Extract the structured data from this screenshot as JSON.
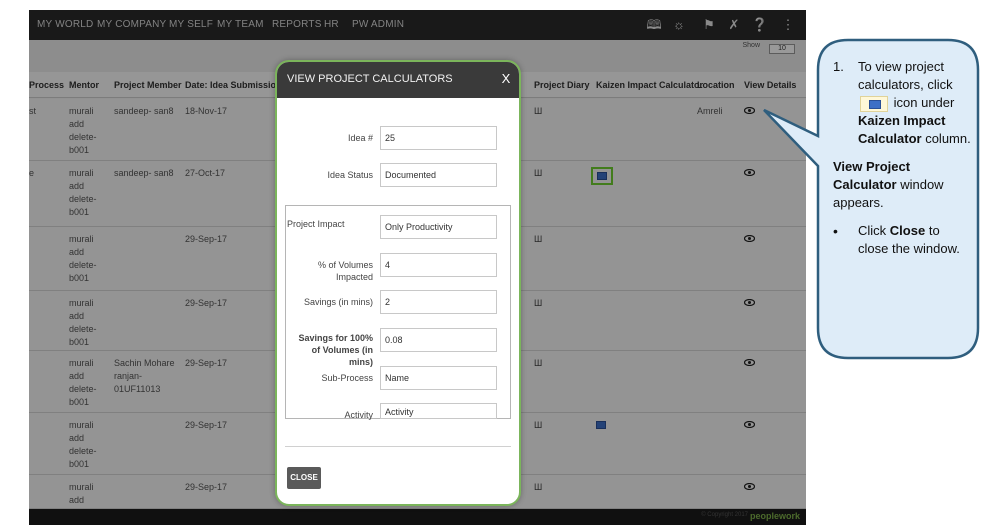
{
  "nav": {
    "items": [
      "MY WORLD",
      "MY COMPANY",
      "MY SELF",
      "MY TEAM",
      "REPORTS",
      "HR",
      "PW ADMIN"
    ],
    "icons": [
      "map-icon",
      "bulb-icon",
      "flag-icon",
      "tools-icon",
      "help-icon",
      "share-icon"
    ]
  },
  "show_label": "Show",
  "show_value": "10",
  "table": {
    "headers": {
      "process": "Process",
      "mentor": "Mentor",
      "member": "Project Member",
      "date": "Date: Idea Submission",
      "diary": "Project Diary",
      "kaizen": "Kaizen Impact Calculator",
      "location": "Location",
      "details": "View Details"
    },
    "rows": [
      {
        "process": "st",
        "mentor": "murali add delete-b001",
        "member": "sandeep- san8",
        "date": "18-Nov-17",
        "location": "Amreli",
        "calc": false
      },
      {
        "process": "e",
        "mentor": "murali add delete-b001",
        "member": "sandeep- san8",
        "date": "27-Oct-17",
        "location": "",
        "calc": true
      },
      {
        "process": "",
        "mentor": "murali add delete-b001",
        "member": "",
        "date": "29-Sep-17",
        "location": "",
        "calc": false
      },
      {
        "process": "",
        "mentor": "murali add delete-b001",
        "member": "",
        "date": "29-Sep-17",
        "location": "",
        "calc": false
      },
      {
        "process": "",
        "mentor": "murali add delete-b001",
        "member": "Sachin Mohare ranjan-01UF11013",
        "date": "29-Sep-17",
        "location": "",
        "calc": false
      },
      {
        "process": "",
        "mentor": "murali add delete-b001",
        "member": "",
        "date": "29-Sep-17",
        "location": "",
        "calc": true
      },
      {
        "process": "",
        "mentor": "murali add",
        "member": "",
        "date": "29-Sep-17",
        "location": "",
        "calc": false
      }
    ]
  },
  "footer": {
    "copyright": "© Copyright 2017",
    "brand": "peoplework"
  },
  "modal": {
    "title": "VIEW PROJECT CALCULATORS",
    "close_x": "X",
    "idea_no_label": "Idea #",
    "idea_no_value": "25",
    "idea_status_label": "Idea Status",
    "idea_status_value": "Documented",
    "project_impact_label": "Project Impact",
    "project_impact_value": "Only Productivity",
    "volumes_label": "% of Volumes Impacted",
    "volumes_value": "4",
    "savings_label": "Savings (in mins)",
    "savings_value": "2",
    "savings100_label": "Savings for 100% of Volumes (in mins)",
    "savings100_value": "0.08",
    "subprocess_label": "Sub-Process",
    "subprocess_value": "Name",
    "activity_label": "Activity",
    "activity_value": "Activity",
    "close_button": "CLOSE"
  },
  "callout": {
    "step_number": "1.",
    "step_text_1": "To view project calculators, click",
    "step_text_2": "icon under",
    "step_bold_1": "Kaizen Impact Calculator",
    "step_text_3": "column.",
    "para_bold": "View Project Calculator",
    "para_text": "window appears.",
    "bullet_prefix": "Click",
    "bullet_bold": "Close",
    "bullet_text": "to close the window.",
    "colors": {
      "fill": "#deecf8",
      "border": "#2f5e7e"
    }
  }
}
